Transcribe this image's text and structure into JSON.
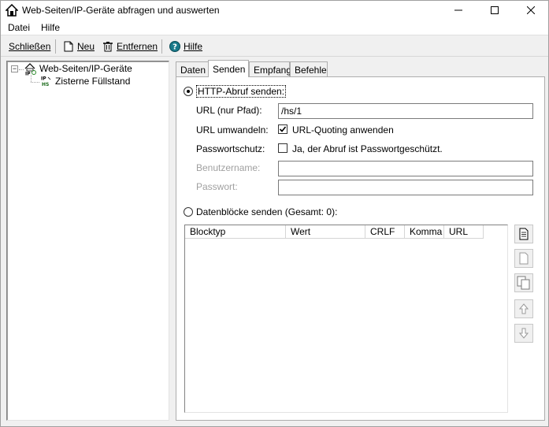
{
  "window": {
    "title": "Web-Seiten/IP-Geräte abfragen und auswerten"
  },
  "menu": {
    "items": [
      "Datei",
      "Hilfe"
    ]
  },
  "toolbar": {
    "close": "Schließen",
    "new": "Neu",
    "remove": "Entfernen",
    "help": "Hilfe"
  },
  "tree": {
    "root": "Web-Seiten/IP-Geräte",
    "child": "Zisterne Füllstand",
    "expander": "−"
  },
  "tabs": [
    "Daten",
    "Senden",
    "Empfang",
    "Befehle"
  ],
  "form": {
    "http_radio_label": "HTTP-Abruf senden:",
    "url_label": "URL (nur Pfad):",
    "url_value": "/hs/1",
    "convert_label": "URL umwandeln:",
    "quoting_label": "URL-Quoting anwenden",
    "password_protect_label": "Passwortschutz:",
    "password_protect_check": "Ja, der Abruf ist Passwortgeschützt.",
    "username_label": "Benutzername:",
    "password_label": "Passwort:",
    "datablocks_radio_label": "Datenblöcke senden (Gesamt: 0):"
  },
  "grid": {
    "columns": [
      "Blocktyp",
      "Wert",
      "CRLF",
      "Komma",
      "URL"
    ]
  },
  "state": {
    "active_tab": "Senden",
    "http_selected": true,
    "quoting_checked": true,
    "password_checked": false
  }
}
